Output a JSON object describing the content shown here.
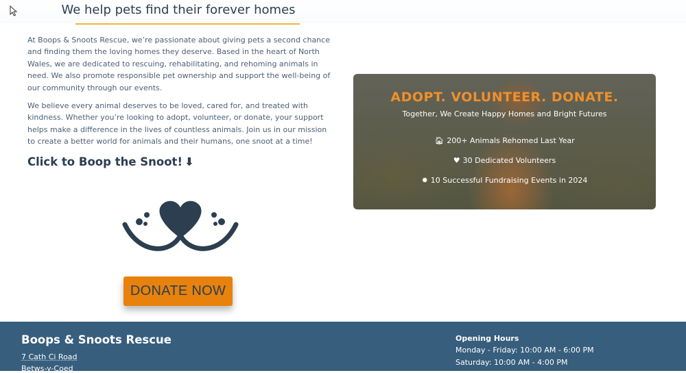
{
  "hero": {
    "title": "We help pets find their forever homes"
  },
  "intro": {
    "paragraph1": "At Boops & Snoots Rescue, we’re passionate about giving pets a second chance and finding them the loving homes they deserve. Based in the heart of North Wales, we are dedicated to rescuing, rehabilitating, and rehoming animals in need. We also promote responsible pet ownership and support the well-being of our community through our events.",
    "paragraph2": "We believe every animal deserves to be loved, cared for, and treated with kindness. Whether you’re looking to adopt, volunteer, or donate, your support helps make a difference in the lives of countless animals. Join us in our mission to create a better world for animals and their humans, one snoot at a time!",
    "boop_label": "Click to Boop the Snoot!",
    "boop_arrow": "⬇",
    "snoot_icon": "snoot-nose-icon"
  },
  "donate": {
    "label": "DONATE NOW",
    "color": "#e8820c"
  },
  "promo": {
    "heading": "ADOPT. VOLUNTEER. DONATE.",
    "subheading": "Together, We Create Happy Homes and Bright Futures",
    "heading_color": "#f0902a",
    "stats": [
      {
        "icon": "house-icon",
        "glyph": "🏠︎",
        "text": "200+ Animals Rehomed Last Year"
      },
      {
        "icon": "heart-icon",
        "glyph": "♥",
        "text": "30 Dedicated Volunteers"
      },
      {
        "icon": "gear-icon",
        "glyph": "✹",
        "text": "10 Successful Fundraising Events in 2024"
      }
    ]
  },
  "footer": {
    "brand": "Boops & Snoots Rescue",
    "address_line1": "7 Cath Ci Road",
    "address_line2": "Betws-y-Coed",
    "hours_title": "Opening Hours",
    "hours_weekday": "Monday - Friday: 10:00 AM - 6:00 PM",
    "hours_saturday": "Saturday: 10:00 AM - 4:00 PM",
    "background": "#375e7d"
  }
}
